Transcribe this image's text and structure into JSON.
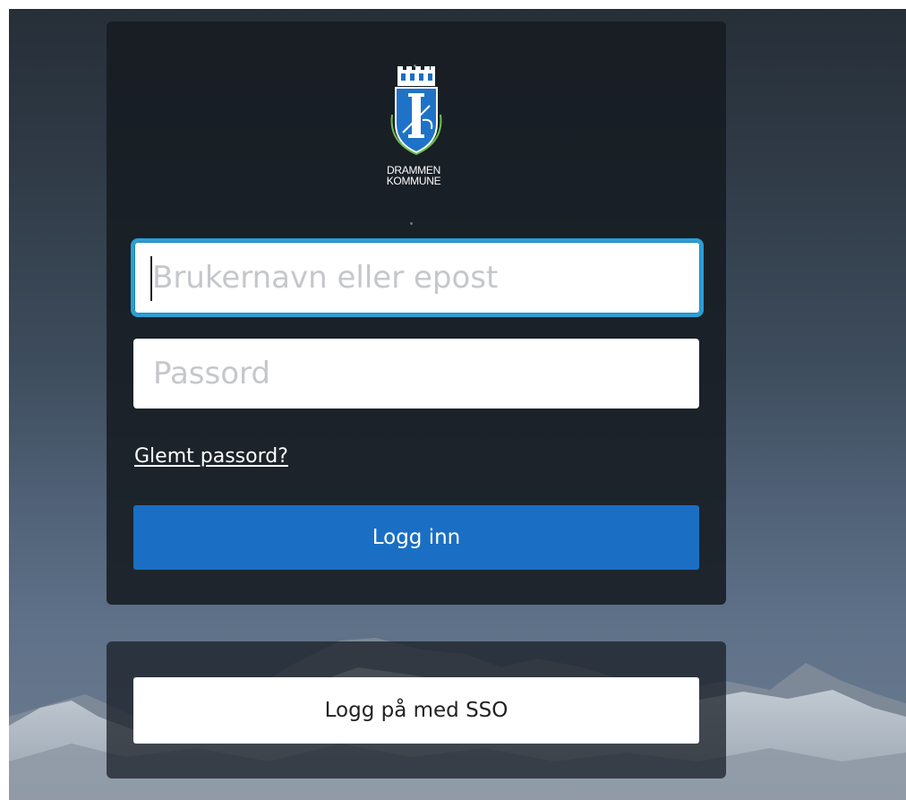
{
  "logo": {
    "line1": "DRAMMEN",
    "line2": "KOMMUNE",
    "icon": "drammen-coat-of-arms-icon"
  },
  "login_form": {
    "username_placeholder": "Brukernavn eller epost",
    "username_value": "",
    "password_placeholder": "Passord",
    "password_value": "",
    "forgot_password_label": "Glemt passord?",
    "login_button_label": "Logg inn"
  },
  "sso": {
    "button_label": "Logg på med SSO"
  },
  "colors": {
    "primary_button": "#1a6fc4",
    "focus_ring": "#2a9fd6",
    "panel": "#161b21"
  }
}
